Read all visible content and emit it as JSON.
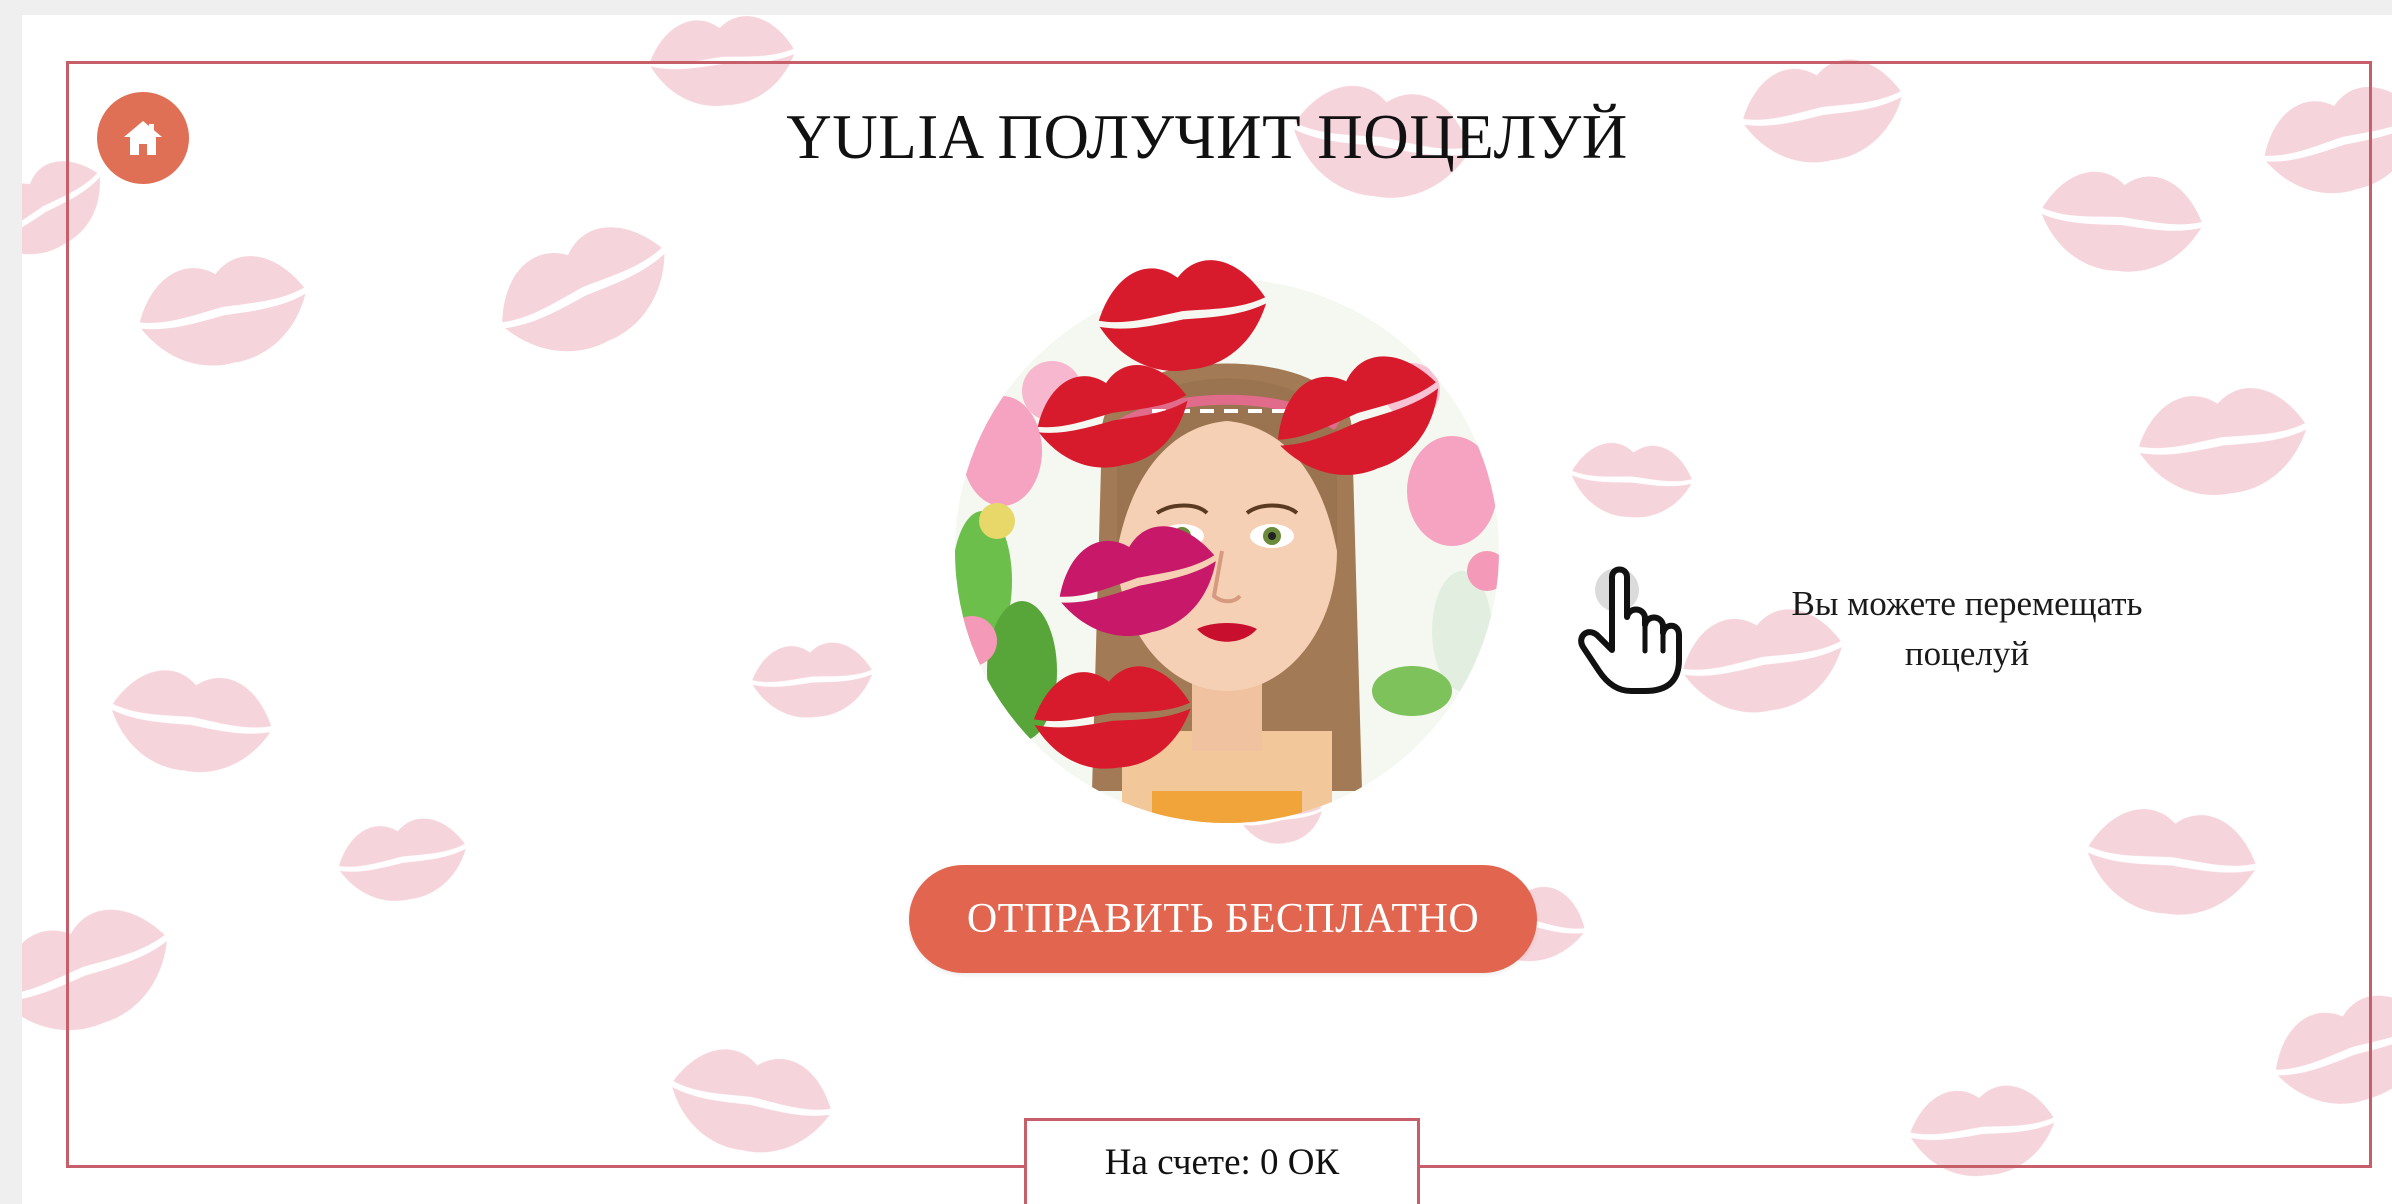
{
  "header": {
    "title": "YULIA ПОЛУЧИТ ПОЦЕЛУЙ",
    "home_icon": "home-icon"
  },
  "avatar": {
    "description_icon": "avatar-with-kisses"
  },
  "hint": {
    "text": "Вы можете перемещать поцелуй",
    "icon": "hand-pointer-icon"
  },
  "actions": {
    "send_label": "ОТПРАВИТЬ БЕСПЛАТНО"
  },
  "footer": {
    "balance_text": "На счете: 0 ОК"
  },
  "colors": {
    "accent": "#e2654f",
    "frame": "#c75f6a",
    "kiss_bg": "#f3c6d0",
    "kiss_red": "#d81b2c"
  }
}
